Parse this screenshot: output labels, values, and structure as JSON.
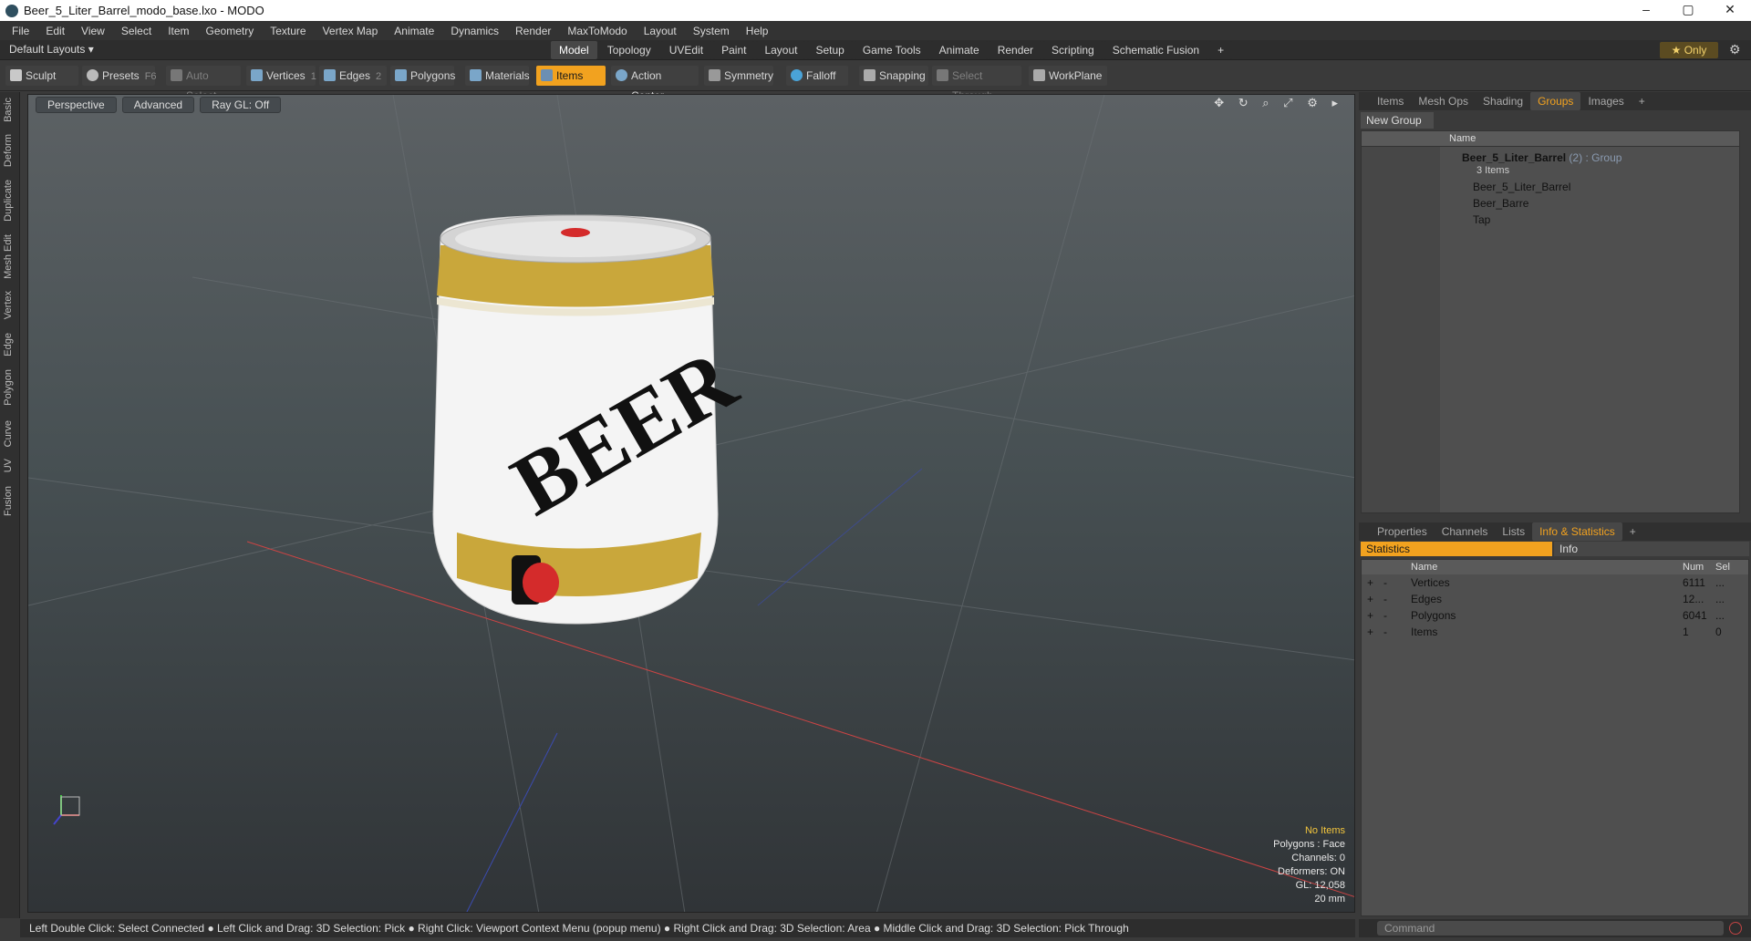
{
  "window": {
    "title": "Beer_5_Liter_Barrel_modo_base.lxo - MODO",
    "minimize": "–",
    "maximize": "▢",
    "close": "✕"
  },
  "menu": [
    "File",
    "Edit",
    "View",
    "Select",
    "Item",
    "Geometry",
    "Texture",
    "Vertex Map",
    "Animate",
    "Dynamics",
    "Render",
    "MaxToModo",
    "Layout",
    "System",
    "Help"
  ],
  "layouts": {
    "default_label": "Default Layouts ▾",
    "tabs": [
      "Model",
      "Topology",
      "UVEdit",
      "Paint",
      "Layout",
      "Setup",
      "Game Tools",
      "Animate",
      "Render",
      "Scripting",
      "Schematic Fusion",
      "+"
    ],
    "active_tab": "Model",
    "only_label": "★  Only"
  },
  "toolbar": {
    "sculpt": "Sculpt",
    "presets": "Presets",
    "presets_key": "F6",
    "auto_select": "Auto Select",
    "vertices": "Vertices",
    "vertices_key": "1",
    "edges": "Edges",
    "edges_key": "2",
    "polygons": "Polygons",
    "materials": "Materials",
    "items": "Items",
    "action_center": "Action Center",
    "symmetry": "Symmetry",
    "falloff": "Falloff",
    "snapping": "Snapping",
    "select_through": "Select Through",
    "workplane": "WorkPlane"
  },
  "left_tabs": [
    "Basic",
    "Deform",
    "Duplicate",
    "Mesh Edit",
    "Vertex",
    "Edge",
    "Polygon",
    "Curve",
    "UV",
    "Fusion"
  ],
  "viewport": {
    "perspective": "Perspective",
    "advanced": "Advanced",
    "raygl": "Ray GL: Off",
    "tools": "✥ ↻ ⌕ ⤢ ⚙ ▸",
    "label_text": "BEER",
    "stats": {
      "no_items": "No Items",
      "polygons": "Polygons : Face",
      "channels": "Channels: 0",
      "deformers": "Deformers: ON",
      "gl": "GL: 12,058",
      "scale": "20 mm"
    }
  },
  "status": "Left Double Click: Select Connected ● Left Click and Drag: 3D Selection: Pick ● Right Click: Viewport Context Menu (popup menu) ● Right Click and Drag: 3D Selection: Area ● Middle Click and Drag: 3D Selection: Pick Through",
  "items_panel": {
    "tabs": [
      "Items",
      "Mesh Ops",
      "Shading",
      "Groups",
      "Images",
      "+"
    ],
    "active_tab": "Groups",
    "new_group": "New Group",
    "name_header": "Name",
    "group_name": "Beer_5_Liter_Barrel",
    "group_count": "(2)",
    "group_type": ": Group",
    "group_sub": "3 Items",
    "children": [
      "Beer_5_Liter_Barrel",
      "Beer_Barre",
      "Tap"
    ]
  },
  "stats_panel": {
    "tabs": [
      "Properties",
      "Channels",
      "Lists",
      "Info & Statistics",
      "+"
    ],
    "active_tab": "Info & Statistics",
    "sub_tabs": [
      "Statistics",
      "Info"
    ],
    "headers": {
      "name": "Name",
      "num": "Num",
      "sel": "Sel"
    },
    "rows": [
      {
        "name": "Vertices",
        "num": "6111",
        "sel": "..."
      },
      {
        "name": "Edges",
        "num": "12...",
        "sel": "..."
      },
      {
        "name": "Polygons",
        "num": "6041",
        "sel": "..."
      },
      {
        "name": "Items",
        "num": "1",
        "sel": "0"
      }
    ]
  },
  "command": {
    "placeholder": "Command"
  }
}
